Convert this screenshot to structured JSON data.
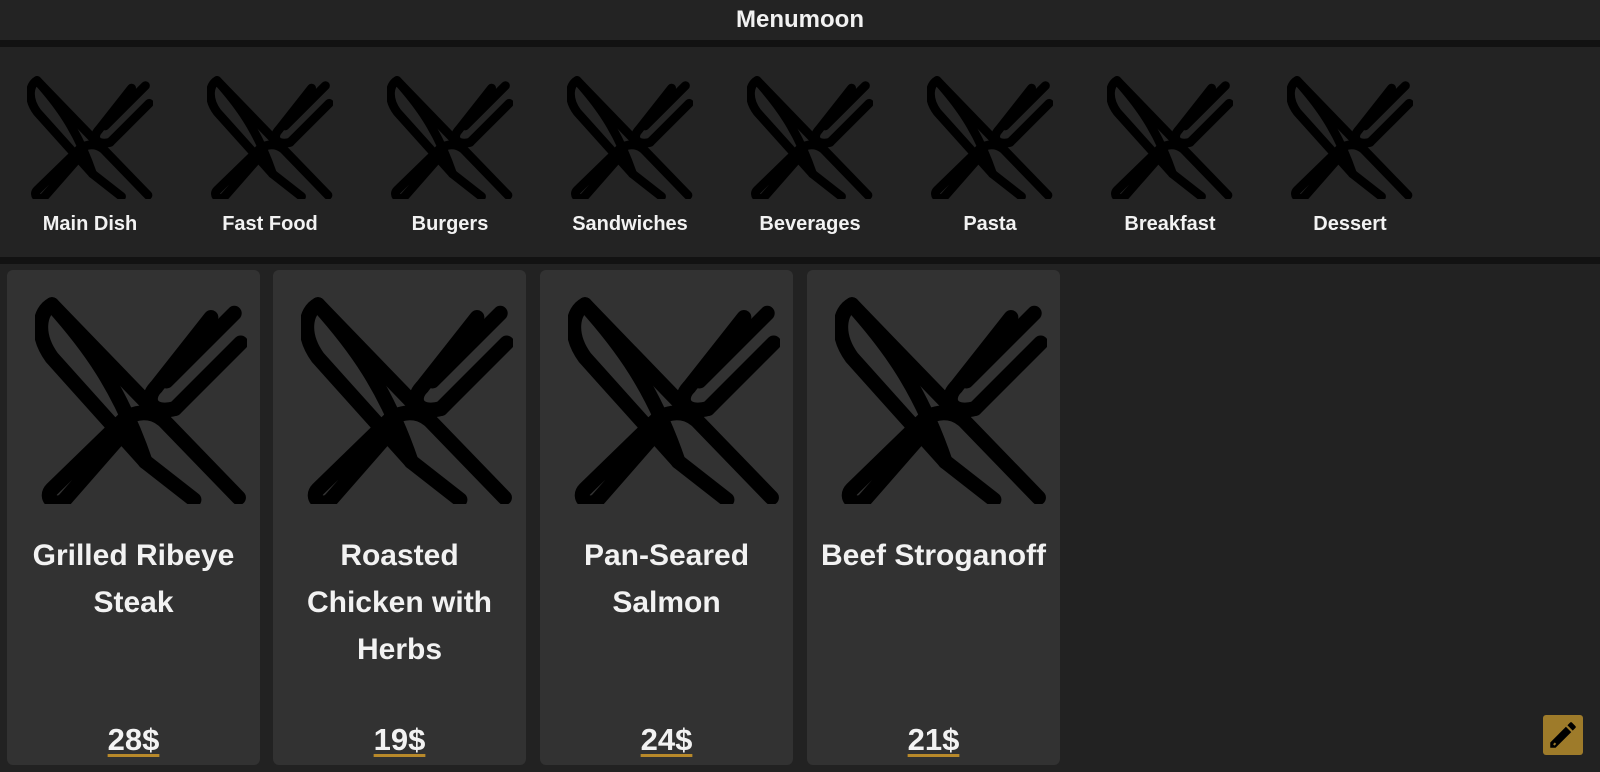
{
  "header": {
    "title": "Menumoon"
  },
  "categories": [
    {
      "label": "Main Dish",
      "icon": "utensils-icon"
    },
    {
      "label": "Fast Food",
      "icon": "utensils-icon"
    },
    {
      "label": "Burgers",
      "icon": "utensils-icon"
    },
    {
      "label": "Sandwiches",
      "icon": "utensils-icon"
    },
    {
      "label": "Beverages",
      "icon": "utensils-icon"
    },
    {
      "label": "Pasta",
      "icon": "utensils-icon"
    },
    {
      "label": "Breakfast",
      "icon": "utensils-icon"
    },
    {
      "label": "Dessert",
      "icon": "utensils-icon"
    }
  ],
  "dishes": [
    {
      "name": "Grilled Ribeye Steak",
      "price": "28$",
      "icon": "utensils-icon"
    },
    {
      "name": "Roasted Chicken with Herbs",
      "price": "19$",
      "icon": "utensils-icon"
    },
    {
      "name": "Pan-Seared Salmon",
      "price": "24$",
      "icon": "utensils-icon"
    },
    {
      "name": "Beef Stroganoff",
      "price": "21$",
      "icon": "utensils-icon"
    }
  ],
  "edit_button": {
    "icon": "pencil-icon"
  },
  "colors": {
    "background": "#222222",
    "card": "#323232",
    "accent": "#9e7b2a",
    "text": "#f2f2f2"
  }
}
